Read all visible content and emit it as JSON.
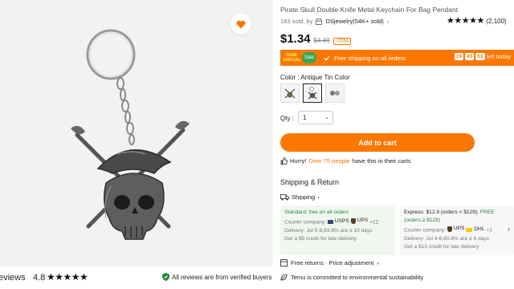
{
  "product": {
    "title": "Pirate Skull Double Knife Metal Keychain For Bag Pendant",
    "sold": "183 sold, by",
    "store": "DSjewelry(54K+ sold)",
    "store_chevron": "›",
    "rating_stars": "★★★★★",
    "rating_count": "(2,100)"
  },
  "price": {
    "current": "$1.34",
    "original": "$4.49",
    "discount": "-70%"
  },
  "promo": {
    "event_label_line1": "SEMI",
    "event_label_line2": "ANNUAL",
    "sale_badge": "Sale",
    "free_shipping": "Free shipping on all orders",
    "timer_h": "19",
    "timer_m": "43",
    "timer_s": "53",
    "left_today": "left today"
  },
  "options": {
    "color_label": "Color : Antique Tin Color",
    "qty_label": "Qty :",
    "qty_value": "1"
  },
  "actions": {
    "add_to_cart": "Add to cart"
  },
  "hurry": {
    "prefix": "Hurry!",
    "highlight": "Over 75 people",
    "suffix": "have this in their carts"
  },
  "shipping": {
    "section_title": "Shipping & Return",
    "link": "Shipping",
    "link_chevron": "›",
    "standard": {
      "head": "Standard: free on all orders",
      "company_label": "Courier company:",
      "carrier1": "USPS",
      "carrier2": "UPS",
      "more": "+12",
      "delivery": "Delivery: Jul 5-8,83.8% are ≤ 10 days",
      "credit": "Get a $5 credit for late delivery"
    },
    "express": {
      "head_prefix": "Express: $12.9 (orders < $129);",
      "head_free": "FREE",
      "head_suffix": "(orders ≥ $129)",
      "company_label": "Courier company:",
      "carrier1": "UPS",
      "carrier2": "DHL",
      "more": "+1",
      "delivery": "Delivery: Jul 4-6,80.8% are ≤ 6 days",
      "credit": "Get a $13 credit for late delivery"
    },
    "next_arrow": "›"
  },
  "returns": {
    "text": "Free returns · Price adjustment",
    "chevron": "›",
    "env": "Temu is committed to environmental sustainability"
  },
  "reviews": {
    "label": "eviews",
    "score": "4.8",
    "stars": "★★★★★",
    "verified": "All reviews are from verified buyers"
  },
  "colors": {
    "accent": "#fb7701",
    "green": "#228833"
  }
}
